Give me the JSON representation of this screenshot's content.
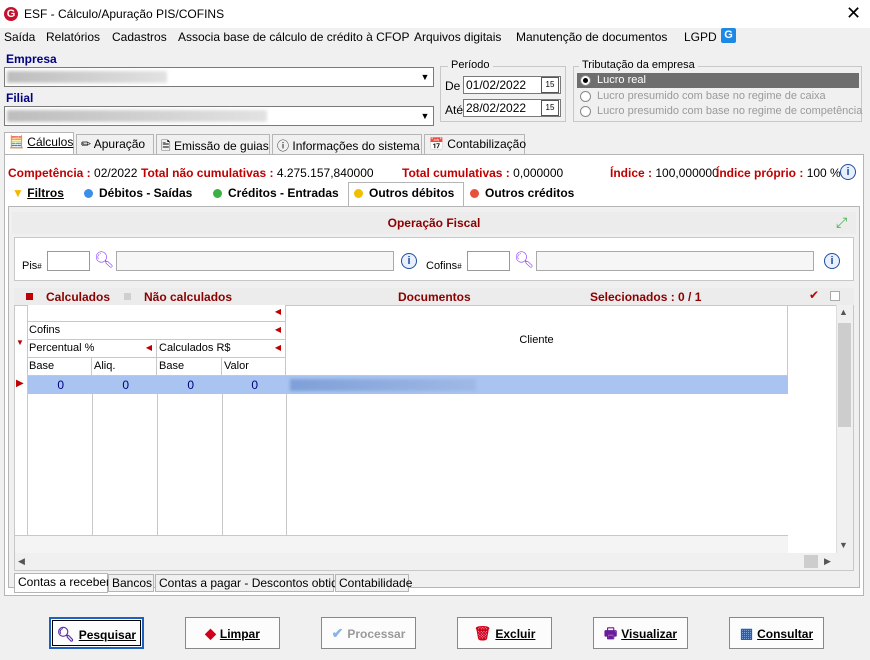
{
  "window": {
    "title": "ESF - Cálculo/Apuração PIS/COFINS",
    "logo_letter": "G",
    "close_glyph": "✕"
  },
  "menu": [
    {
      "label": "Saída"
    },
    {
      "label": "Relatórios"
    },
    {
      "label": "Cadastros"
    },
    {
      "label": "Associa base de cálculo de crédito à CFOP"
    },
    {
      "label": "Arquivos digitais"
    },
    {
      "label": "Manutenção de documentos"
    },
    {
      "label": "LGPD"
    }
  ],
  "lgpd_icon": "G",
  "empresa": {
    "label": "Empresa"
  },
  "filial": {
    "label": "Filial"
  },
  "periodo": {
    "title": "Período",
    "de_label": "De",
    "de_value": "01/02/2022",
    "ate_label": "Até",
    "ate_value": "28/02/2022",
    "cal_glyph": "15"
  },
  "tributacao": {
    "title": "Tributação da empresa",
    "options": [
      {
        "label": "Lucro real",
        "selected": true
      },
      {
        "label": "Lucro presumido com base no regime de caixa",
        "selected": false
      },
      {
        "label": "Lucro presumido com base no regime de competência",
        "selected": false
      }
    ]
  },
  "main_tabs": [
    {
      "label": "Cálculos",
      "icon": "calc-icon"
    },
    {
      "label": "Apuração",
      "icon": "edit-icon"
    },
    {
      "label": "Emissão de guias",
      "icon": "document-icon"
    },
    {
      "label": "Informações do sistema",
      "icon": "info-icon"
    },
    {
      "label": "Contabilização",
      "icon": "calendar-icon"
    }
  ],
  "summary": {
    "competencia_label": "Competência :",
    "competencia_value": "02/2022",
    "nao_cumul_label": "Total não cumulativas :",
    "nao_cumul_value": "4.275.157,840000",
    "cumul_label": "Total cumulativas :",
    "cumul_value": "0,000000",
    "indice_label": "Índice :",
    "indice_value": "100,000000",
    "indice_proprio_label": "Índice próprio :",
    "indice_proprio_value": "100 %"
  },
  "sub_tabs": [
    {
      "label": "Filtros",
      "dot": "#f5b800"
    },
    {
      "label": "Débitos - Saídas",
      "dot": "#3a8fe8"
    },
    {
      "label": "Créditos - Entradas",
      "dot": "#3cb043"
    },
    {
      "label": "Outros débitos",
      "dot": "#f0c000"
    },
    {
      "label": "Outros créditos",
      "dot": "#e8503a"
    }
  ],
  "operacao": {
    "title": "Operação Fiscal",
    "pis_label": "Pis",
    "cofins_label": "Cofins",
    "hash_glyph": "#"
  },
  "grid_legend": {
    "calculados": "Calculados",
    "nao_calculados": "Não calculados",
    "documentos": "Documentos",
    "selecionados": "Selecionados : 0 / 1"
  },
  "grid_headers": {
    "cofins": "Cofins",
    "percentual": "Percentual %",
    "calculados_rs": "Calculados R$",
    "base": "Base",
    "aliq": "Aliq.",
    "base2": "Base",
    "valor": "Valor",
    "cliente": "Cliente"
  },
  "grid_rows": [
    {
      "base": "0",
      "aliq": "0",
      "base2": "0",
      "valor": "0"
    }
  ],
  "bottom_tabs": [
    {
      "label": "Contas a receber"
    },
    {
      "label": "Bancos"
    },
    {
      "label": "Contas a pagar - Descontos obtidos"
    },
    {
      "label": "Contabilidade"
    }
  ],
  "buttons": {
    "pesquisar": "Pesquisar",
    "limpar": "Limpar",
    "processar": "Processar",
    "excluir": "Excluir",
    "visualizar": "Visualizar",
    "consultar": "Consultar"
  },
  "colors": {
    "accent_red": "#c00000",
    "header_red": "#8b0000",
    "selection": "#a9c4f0",
    "label_blue": "#000080"
  }
}
